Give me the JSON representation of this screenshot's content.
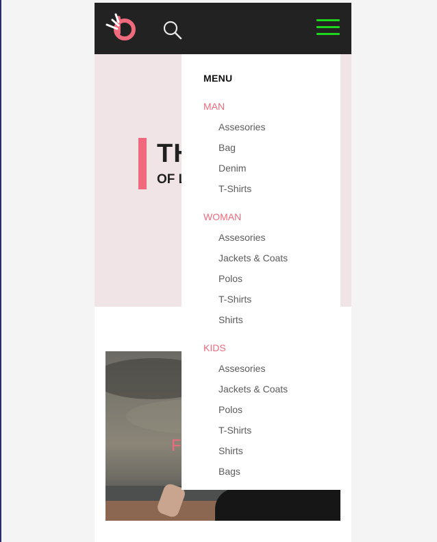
{
  "colors": {
    "header_bg": "#222222",
    "accent": "#ef6a7d",
    "hamburger": "#1ed81e",
    "hero_bg": "#f0e4e6"
  },
  "header": {
    "logo_icon": "brand-logo-icon",
    "search_icon": "search-icon",
    "menu_icon": "hamburger-icon"
  },
  "hero": {
    "title": "TH",
    "subtitle": "OF L"
  },
  "promo": {
    "text": "F"
  },
  "menu": {
    "title": "MENU",
    "categories": [
      {
        "label": "MAN",
        "items": [
          "Assesories",
          "Bag",
          "Denim",
          "T-Shirts"
        ]
      },
      {
        "label": "WOMAN",
        "items": [
          "Assesories",
          "Jackets & Coats",
          "Polos",
          "T-Shirts",
          "Shirts"
        ]
      },
      {
        "label": "KIDS",
        "items": [
          "Assesories",
          "Jackets & Coats",
          "Polos",
          "T-Shirts",
          "Shirts",
          "Bags"
        ]
      }
    ]
  }
}
